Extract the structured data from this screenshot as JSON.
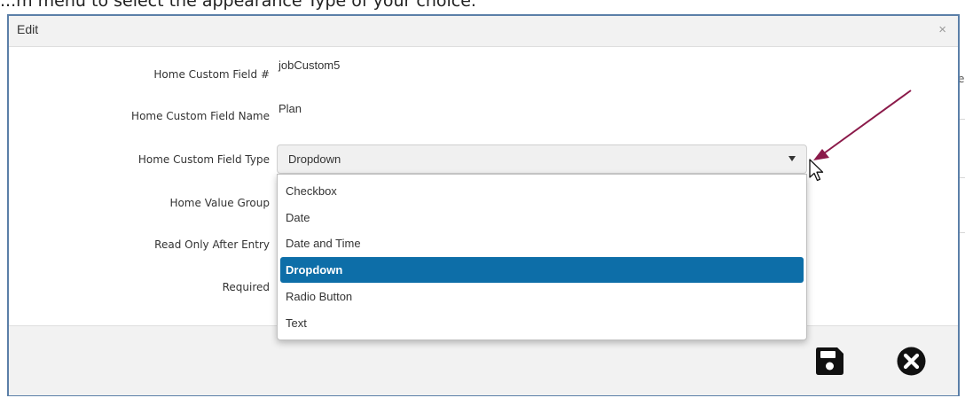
{
  "background": {
    "caption": "...m menu to select the appearance Type of your choice.",
    "edge_letter": "e"
  },
  "modal": {
    "title": "Edit",
    "close_glyph": "×"
  },
  "form": {
    "rows": [
      {
        "label": "Home Custom Field #",
        "value": "jobCustom5"
      },
      {
        "label": "Home Custom Field Name",
        "value": "Plan"
      },
      {
        "label": "Home Custom Field Type"
      },
      {
        "label": "Home Value Group"
      },
      {
        "label": "Read Only After Entry"
      },
      {
        "label": "Required"
      }
    ],
    "type_select": {
      "selected": "Dropdown",
      "options": [
        "Checkbox",
        "Date",
        "Date and Time",
        "Dropdown",
        "Radio Button",
        "Text"
      ]
    }
  },
  "footer": {
    "save_icon": "floppy-disk-icon",
    "cancel_icon": "circle-x-icon"
  },
  "colors": {
    "modal_border": "#5b7fa8",
    "selected_option": "#0d6ea8",
    "arrow": "#8b1a4a"
  }
}
